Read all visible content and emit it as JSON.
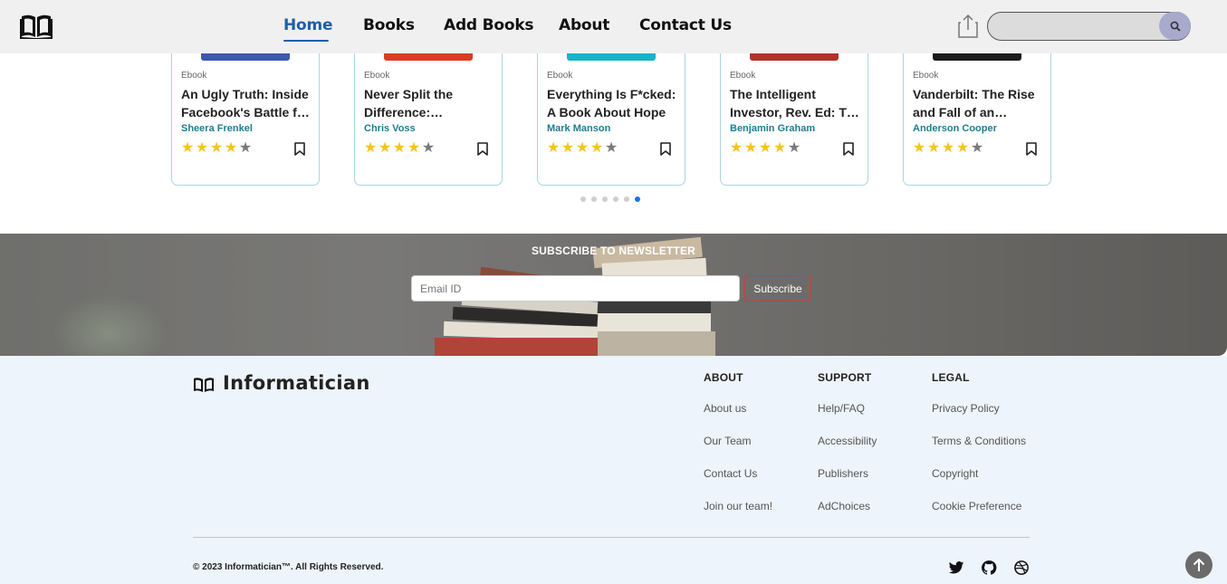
{
  "navbar": {
    "logo_icon": "open-book-icon",
    "links": [
      {
        "label": "Home",
        "active": true
      },
      {
        "label": "Books",
        "active": false
      },
      {
        "label": "Add Books",
        "active": false
      },
      {
        "label": "About",
        "active": false
      },
      {
        "label": "Contact Us",
        "active": false
      }
    ],
    "share_icon": "share-icon",
    "search": {
      "value": "",
      "placeholder": "",
      "icon": "search-icon"
    }
  },
  "books": [
    {
      "type": "Ebook",
      "title": "An Ugly Truth: Inside Facebook's Battle for Domination",
      "author": "Sheera Frenkel",
      "rating": 4,
      "max_rating": 5,
      "cover_color": "#3d5aa8"
    },
    {
      "type": "Ebook",
      "title": "Never Split the Difference: Negotiating As If Your Life Depended On It",
      "author": "Chris Voss",
      "rating": 4,
      "max_rating": 5,
      "cover_color": "#e03a26"
    },
    {
      "type": "Ebook",
      "title": "Everything Is F*cked: A Book About Hope",
      "author": "Mark Manson",
      "rating": 4,
      "max_rating": 5,
      "cover_color": "#14b5c4"
    },
    {
      "type": "Ebook",
      "title": "The Intelligent Investor, Rev. Ed: The Definitive Book on Value Investing",
      "author": "Benjamin Graham",
      "rating": 4,
      "max_rating": 5,
      "cover_color": "#b2322a"
    },
    {
      "type": "Ebook",
      "title": "Vanderbilt: The Rise and Fall of an American Dynasty",
      "author": "Anderson Cooper",
      "rating": 4,
      "max_rating": 5,
      "cover_color": "#1a1a1a"
    }
  ],
  "carousel": {
    "dot_count": 6,
    "active_index": 5
  },
  "newsletter": {
    "title": "SUBSCRIBE TO NEWSLETTER",
    "email_placeholder": "Email ID",
    "button_label": "Subscribe"
  },
  "footer": {
    "brand": "Informatician",
    "columns": [
      {
        "heading": "ABOUT",
        "links": [
          "About us",
          "Our Team",
          "Contact Us",
          "Join our team!"
        ]
      },
      {
        "heading": "SUPPORT",
        "links": [
          "Help/FAQ",
          "Accessibility",
          "Publishers",
          "AdChoices"
        ]
      },
      {
        "heading": "LEGAL",
        "links": [
          "Privacy Policy",
          "Terms & Conditions",
          "Copyright",
          "Cookie Preference"
        ]
      }
    ],
    "copyright": "© 2023 Informatician™. All Rights Reserved.",
    "social_icons": [
      "twitter-icon",
      "github-icon",
      "dribbble-icon"
    ]
  },
  "scroll_top_icon": "arrow-up-icon",
  "colors": {
    "nav_active": "#1f5fa8",
    "author": "#1b7f8d",
    "star_on": "#f5c518",
    "star_off": "#7a7a7a",
    "dot_active": "#1a73e8",
    "footer_bg": "#edf4fb",
    "subscribe_border": "#d23b3b"
  }
}
